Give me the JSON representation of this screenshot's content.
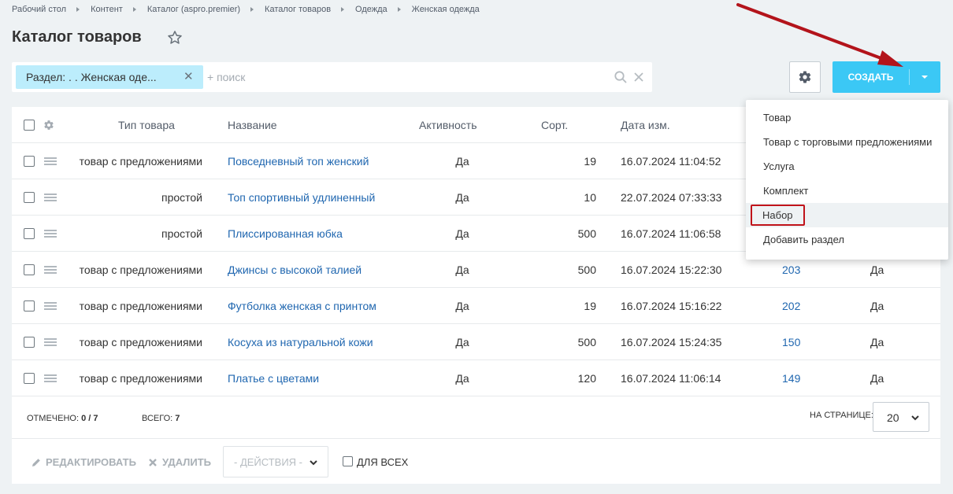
{
  "breadcrumb": [
    "Рабочий стол",
    "Контент",
    "Каталог (aspro.premier)",
    "Каталог товаров",
    "Одежда",
    "Женская одежда"
  ],
  "page_title": "Каталог товаров",
  "filter": {
    "chip_label": "Раздел: . . Женская оде...",
    "search_placeholder": "+ поиск"
  },
  "toolbar": {
    "create_label": "СОЗДАТЬ"
  },
  "table": {
    "columns": [
      "Тип товара",
      "Название",
      "Активность",
      "Сорт.",
      "Дата изм."
    ],
    "rows": [
      {
        "type": "товар с предложениями",
        "name": "Повседневный топ женский",
        "active": "Да",
        "sort": "19",
        "date": "16.07.2024 11:04:52",
        "id": "",
        "extra": ""
      },
      {
        "type": "простой",
        "name": "Топ спортивный удлиненный",
        "active": "Да",
        "sort": "10",
        "date": "22.07.2024 07:33:33",
        "id": "",
        "extra": ""
      },
      {
        "type": "простой",
        "name": "Плиссированная юбка",
        "active": "Да",
        "sort": "500",
        "date": "16.07.2024 11:06:58",
        "id": "",
        "extra": ""
      },
      {
        "type": "товар с предложениями",
        "name": "Джинсы с высокой талией",
        "active": "Да",
        "sort": "500",
        "date": "16.07.2024 15:22:30",
        "id": "203",
        "extra": "Да"
      },
      {
        "type": "товар с предложениями",
        "name": "Футболка женская с принтом",
        "active": "Да",
        "sort": "19",
        "date": "16.07.2024 15:16:22",
        "id": "202",
        "extra": "Да"
      },
      {
        "type": "товар с предложениями",
        "name": "Косуха из натуральной кожи",
        "active": "Да",
        "sort": "500",
        "date": "16.07.2024 15:24:35",
        "id": "150",
        "extra": "Да"
      },
      {
        "type": "товар с предложениями",
        "name": "Платье с цветами",
        "active": "Да",
        "sort": "120",
        "date": "16.07.2024 11:06:14",
        "id": "149",
        "extra": "Да"
      }
    ]
  },
  "footer": {
    "selected_label": "ОТМЕЧЕНО:",
    "selected_value": "0 / 7",
    "total_label": "ВСЕГО:",
    "total_value": "7",
    "per_page_label": "НА СТРАНИЦЕ:",
    "per_page_value": "20"
  },
  "actions": {
    "edit": "РЕДАКТИРОВАТЬ",
    "delete": "УДАЛИТЬ",
    "select": "- ДЕЙСТВИЯ -",
    "for_all": "ДЛЯ ВСЕХ"
  },
  "create_menu": [
    "Товар",
    "Товар с торговыми предложениями",
    "Услуга",
    "Комплект",
    "Набор",
    "Добавить раздел"
  ],
  "colors": {
    "accent": "#3bc8f5",
    "link": "#2067b0",
    "chip": "#bcedfc",
    "highlight_box": "#c0131a",
    "annotation_arrow": "#b3141b"
  }
}
